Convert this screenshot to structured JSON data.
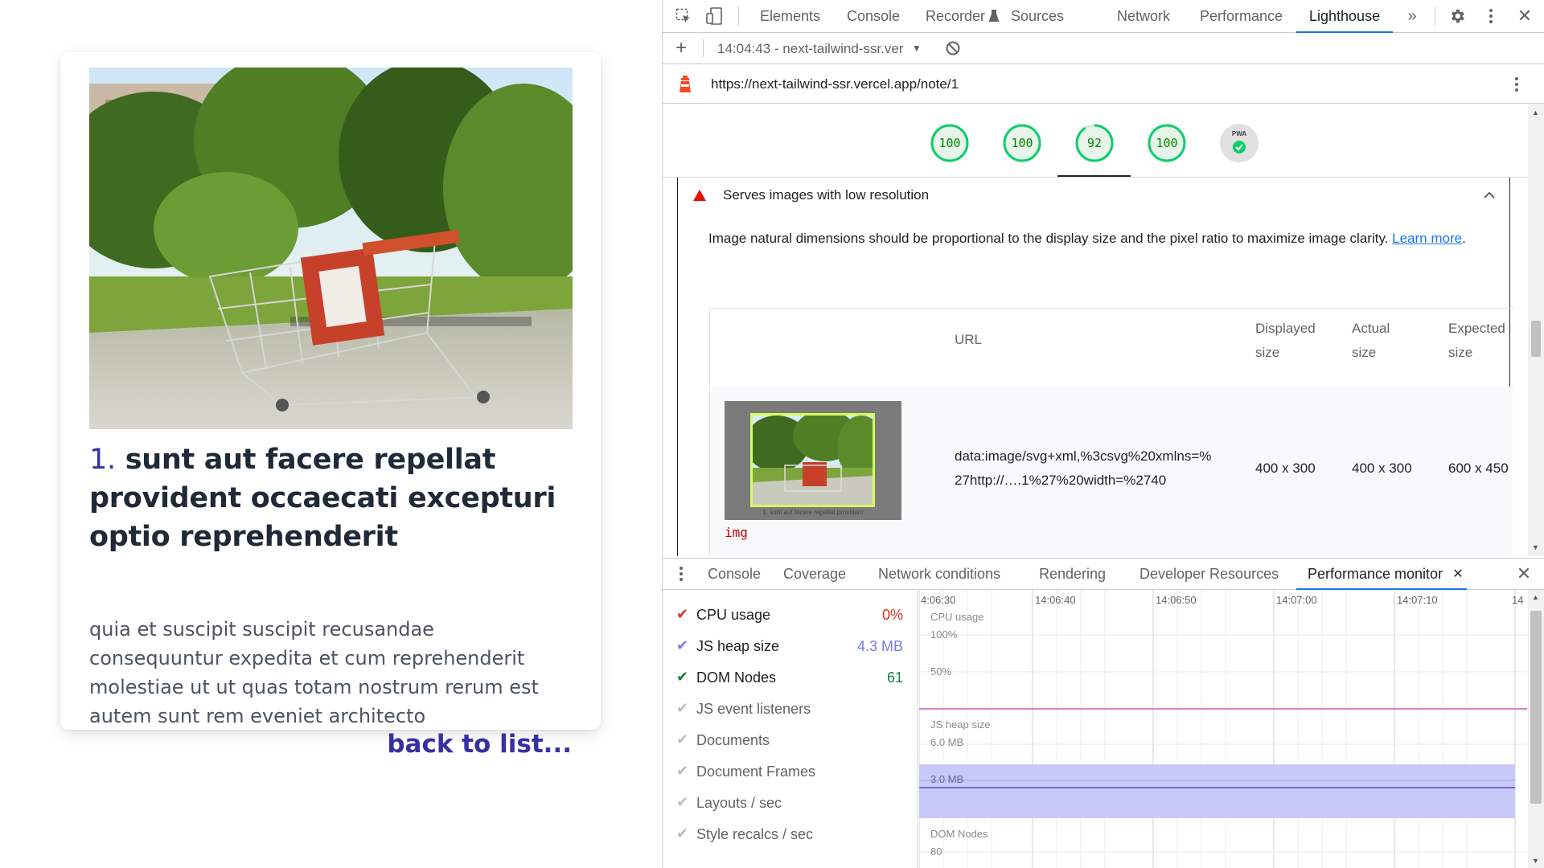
{
  "page": {
    "note_number": "1.",
    "note_title": "sunt aut facere repellat provident occaecati excepturi optio reprehenderit",
    "note_body": "quia et suscipit suscipit recusandae consequuntur expedita et cum reprehenderit molestiae ut ut quas totam nostrum rerum est autem sunt rem eveniet architecto",
    "back_link": "back to list..."
  },
  "devtools": {
    "tabs": [
      "Elements",
      "Console",
      "Recorder",
      "Sources",
      "Network",
      "Performance",
      "Lighthouse"
    ],
    "active_tab": "Lighthouse",
    "report_selector": "14:04:43 - next-tailwind-ssr.ver",
    "report_url": "https://next-tailwind-ssr.vercel.app/note/1",
    "scores": [
      "100",
      "100",
      "92",
      "100"
    ],
    "pwa_label": "PWA",
    "audit": {
      "title": "Serves images with low resolution",
      "description": "Image natural dimensions should be proportional to the display size and the pixel ratio to maximize image clarity.",
      "learn_more": "Learn more",
      "columns": {
        "url": "URL",
        "displayed_line1": "Displayed",
        "displayed_line2": "size",
        "actual_line1": "Actual",
        "actual_line2": "size",
        "expected_line1": "Expected",
        "expected_line2": "size"
      },
      "row": {
        "url_line1": "data:image/svg+xml,%3csvg%20xmlns=%",
        "url_line2": "27http://….1%27%20width=%2740",
        "displayed": "400 x 300",
        "actual": "400 x 300",
        "expected": "600 x 450",
        "tag": "img",
        "thumb_caption": "1. sunt aut facere repellat provident"
      }
    },
    "drawer": {
      "tabs": [
        "Console",
        "Coverage",
        "Network conditions",
        "Rendering",
        "Developer Resources",
        "Performance monitor"
      ],
      "active_tab": "Performance monitor"
    },
    "perf_monitor": {
      "metrics": [
        {
          "label": "CPU usage",
          "value": "0%",
          "enabled": true,
          "color": "#d93025"
        },
        {
          "label": "JS heap size",
          "value": "4.3 MB",
          "enabled": true,
          "color": "#7b7be8"
        },
        {
          "label": "DOM Nodes",
          "value": "61",
          "enabled": true,
          "color": "#188038"
        },
        {
          "label": "JS event listeners",
          "value": "",
          "enabled": false,
          "color": "#bdbdbd"
        },
        {
          "label": "Documents",
          "value": "",
          "enabled": false,
          "color": "#bdbdbd"
        },
        {
          "label": "Document Frames",
          "value": "",
          "enabled": false,
          "color": "#bdbdbd"
        },
        {
          "label": "Layouts / sec",
          "value": "",
          "enabled": false,
          "color": "#bdbdbd"
        },
        {
          "label": "Style recalcs / sec",
          "value": "",
          "enabled": false,
          "color": "#bdbdbd"
        }
      ],
      "time_labels": [
        "4:06:30",
        "14:06:40",
        "14:06:50",
        "14:07:00",
        "14:07:10",
        "14"
      ],
      "cpu_label": "CPU usage",
      "cpu_ticks": [
        "100%",
        "50%"
      ],
      "heap_label": "JS heap size",
      "heap_ticks": [
        "6.0 MB",
        "3.0 MB"
      ],
      "dom_label": "DOM Nodes",
      "dom_ticks": [
        "80"
      ]
    }
  }
}
